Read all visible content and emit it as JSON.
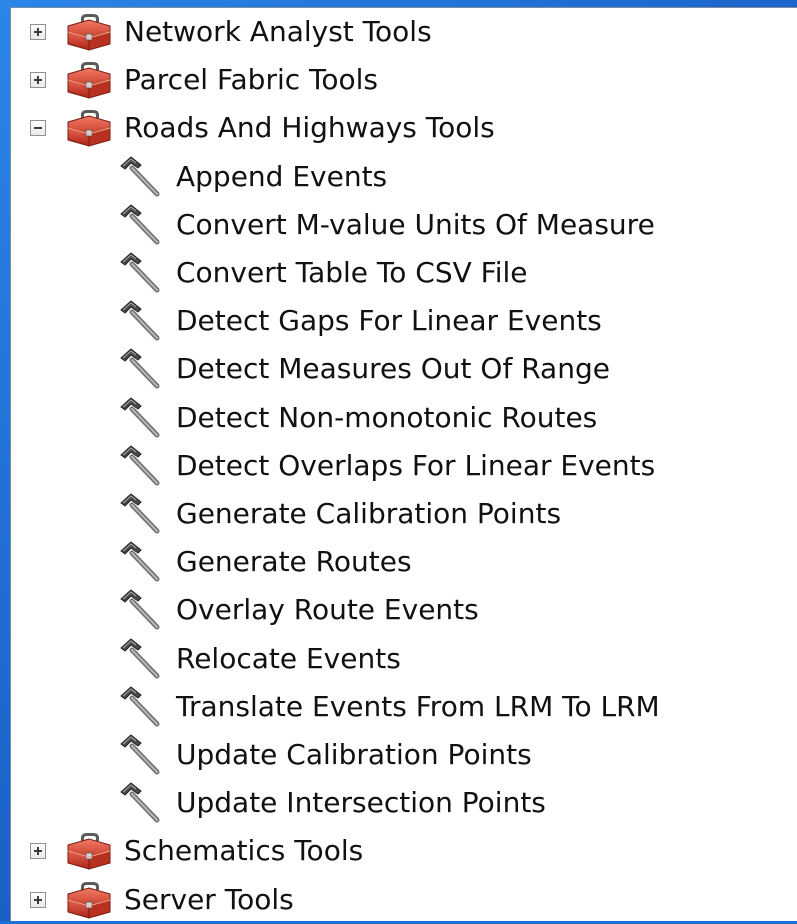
{
  "tree": {
    "items": [
      {
        "label": "Network Analyst Tools",
        "type": "toolbox",
        "state": "collapsed"
      },
      {
        "label": "Parcel Fabric Tools",
        "type": "toolbox",
        "state": "collapsed"
      },
      {
        "label": "Roads And Highways Tools",
        "type": "toolbox",
        "state": "expanded",
        "children": [
          {
            "label": "Append Events",
            "type": "tool"
          },
          {
            "label": "Convert M-value Units Of Measure",
            "type": "tool"
          },
          {
            "label": "Convert Table To CSV File",
            "type": "tool"
          },
          {
            "label": "Detect Gaps For Linear Events",
            "type": "tool"
          },
          {
            "label": "Detect Measures Out Of Range",
            "type": "tool"
          },
          {
            "label": "Detect Non-monotonic Routes",
            "type": "tool"
          },
          {
            "label": "Detect Overlaps For Linear Events",
            "type": "tool"
          },
          {
            "label": "Generate Calibration Points",
            "type": "tool"
          },
          {
            "label": "Generate Routes",
            "type": "tool"
          },
          {
            "label": "Overlay Route Events",
            "type": "tool"
          },
          {
            "label": "Relocate Events",
            "type": "tool"
          },
          {
            "label": "Translate Events From LRM To LRM",
            "type": "tool"
          },
          {
            "label": "Update Calibration Points",
            "type": "tool"
          },
          {
            "label": "Update Intersection Points",
            "type": "tool"
          }
        ]
      },
      {
        "label": "Schematics Tools",
        "type": "toolbox",
        "state": "collapsed"
      },
      {
        "label": "Server Tools",
        "type": "toolbox",
        "state": "collapsed"
      }
    ]
  },
  "icons": {
    "toolbox": "toolbox-icon",
    "tool": "hammer-icon",
    "expand": "expand-plus-icon",
    "collapse": "collapse-minus-icon"
  },
  "colors": {
    "frame_blue": "#1e6fd6",
    "toolbox_red": "#c0392b",
    "panel_bg": "#ffffff"
  }
}
